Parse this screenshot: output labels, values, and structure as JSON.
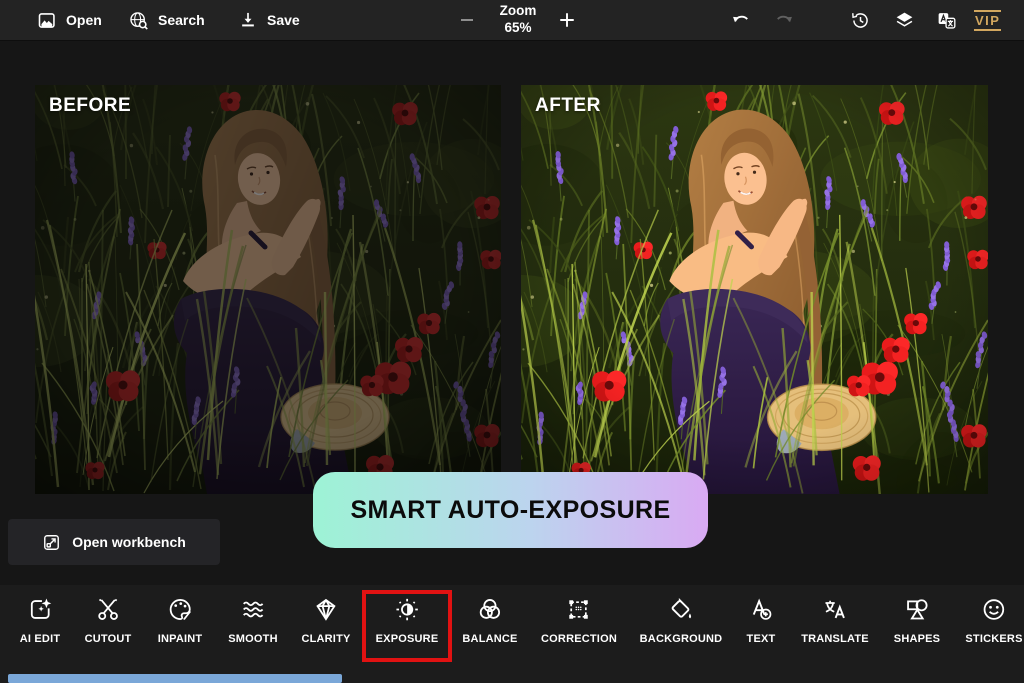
{
  "toolbar_top": {
    "open_label": "Open",
    "search_label": "Search",
    "save_label": "Save",
    "zoom_label": "Zoom",
    "zoom_value": "65%",
    "vip_label": "VIP"
  },
  "comparison": {
    "before_label": "BEFORE",
    "after_label": "AFTER",
    "photo_description": "Smiling woman with long light-brown hair in a dark purple off-shoulder dress, sitting in a wildflower meadow with red poppies, purple vetch spikes and a straw hat"
  },
  "banner": {
    "text": "SMART AUTO-EXPOSURE",
    "gradient_from": "#9df3d5",
    "gradient_to": "#d9aaf3",
    "text_color": "#0b0b0b"
  },
  "workbench": {
    "label": "Open workbench"
  },
  "toolbar_bottom": {
    "items": [
      {
        "label": "AI EDIT",
        "icon": "ai-edit-icon"
      },
      {
        "label": "CUTOUT",
        "icon": "cutout-scissors-icon"
      },
      {
        "label": "INPAINT",
        "icon": "inpaint-palette-icon"
      },
      {
        "label": "SMOOTH",
        "icon": "smooth-waves-icon"
      },
      {
        "label": "CLARITY",
        "icon": "clarity-gem-icon"
      },
      {
        "label": "EXPOSURE",
        "icon": "exposure-sun-icon",
        "highlighted": true
      },
      {
        "label": "BALANCE",
        "icon": "balance-circles-icon"
      },
      {
        "label": "CORRECTION",
        "icon": "correction-frame-icon"
      },
      {
        "label": "BACKGROUND",
        "icon": "background-fill-icon"
      },
      {
        "label": "TEXT",
        "icon": "text-add-icon"
      },
      {
        "label": "TRANSLATE",
        "icon": "translate-lang-icon"
      },
      {
        "label": "SHAPES",
        "icon": "shapes-icon"
      },
      {
        "label": "STICKERS",
        "icon": "stickers-smiley-icon"
      }
    ],
    "highlight_color": "#e11212",
    "scrollbar_color": "#7aa7d8"
  },
  "colors": {
    "topbar_bg": "#232323",
    "canvas_bg": "#161616",
    "bottombar_bg": "#1c1c1c",
    "vip_gold": "#d2a75f",
    "redo_disabled": "#606060",
    "zoom_minus_dimmed": "#9a9a9a"
  }
}
